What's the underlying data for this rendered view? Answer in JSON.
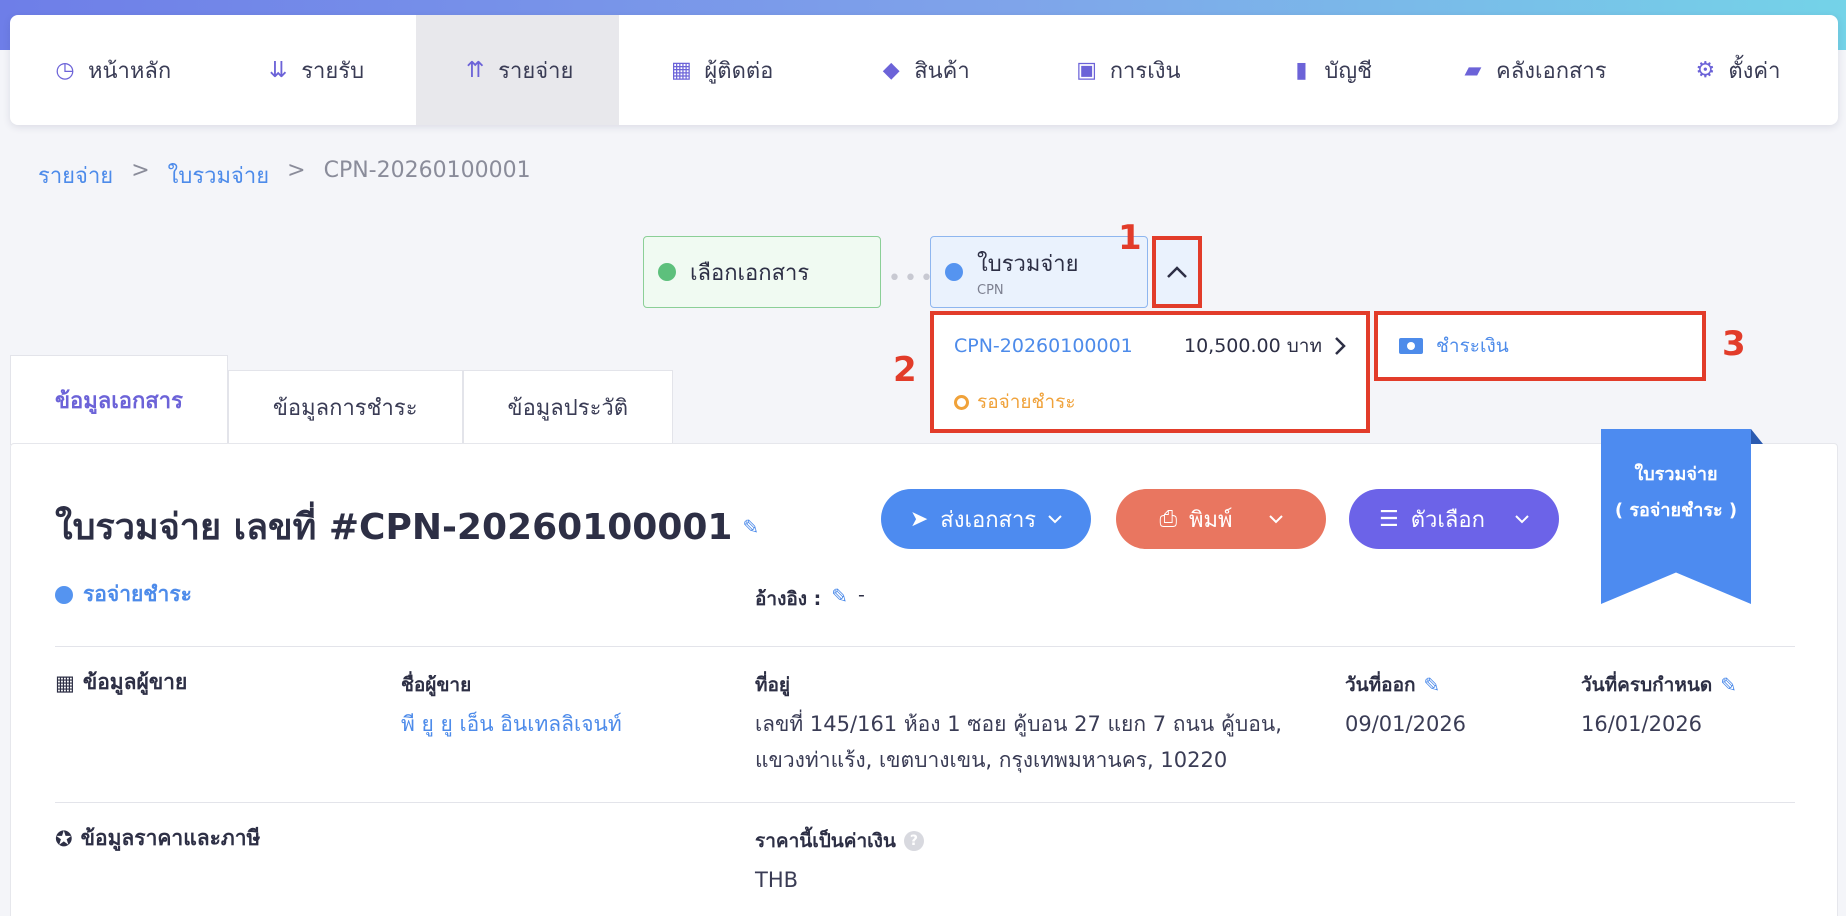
{
  "nav": [
    {
      "label": "หน้าหลัก",
      "icon": "dashboard-icon",
      "glyph": "◷",
      "active": false
    },
    {
      "label": "รายรับ",
      "icon": "income-icon",
      "glyph": "⇊",
      "active": false
    },
    {
      "label": "รายจ่าย",
      "icon": "expense-icon",
      "glyph": "⇈",
      "active": true
    },
    {
      "label": "ผู้ติดต่อ",
      "icon": "contacts-icon",
      "glyph": "▦",
      "active": false
    },
    {
      "label": "สินค้า",
      "icon": "box-icon",
      "glyph": "◆",
      "active": false
    },
    {
      "label": "การเงิน",
      "icon": "money-icon",
      "glyph": "▣",
      "active": false
    },
    {
      "label": "บัญชี",
      "icon": "ledger-icon",
      "glyph": "▮",
      "active": false
    },
    {
      "label": "คลังเอกสาร",
      "icon": "folder-icon",
      "glyph": "▰",
      "active": false
    },
    {
      "label": "ตั้งค่า",
      "icon": "gear-icon",
      "glyph": "⚙",
      "active": false
    }
  ],
  "breadcrumb": {
    "items": [
      "รายจ่าย",
      "ใบรวมจ่าย"
    ],
    "separator": ">",
    "current": "CPN-20260100001"
  },
  "steps": {
    "step1": {
      "label": "เลือกเอกสาร"
    },
    "step2": {
      "label": "ใบรวมจ่าย",
      "sub": "CPN"
    },
    "connector": "•••"
  },
  "annotations": {
    "a1": "1",
    "a2": "2",
    "a3": "3"
  },
  "dropdown": {
    "doc_no": "CPN-20260100001",
    "amount": "10,500.00 บาท",
    "status": "รอจ่ายชำระ",
    "action": "ชำระเงิน"
  },
  "tabs": [
    "ข้อมูลเอกสาร",
    "ข้อมูลการชำระ",
    "ข้อมูลประวัติ"
  ],
  "document": {
    "title": "ใบรวมจ่าย เลขที่ #CPN-20260100001",
    "status": "รอจ่ายชำระ",
    "reference_label": "อ้างอิง :",
    "reference_value": "-",
    "buttons": {
      "send": "ส่งเอกสาร",
      "print": "พิมพ์",
      "options": "ตัวเลือก"
    },
    "ribbon": {
      "line1": "ใบรวมจ่าย",
      "line2": "( รอจ่ายชำระ )"
    }
  },
  "vendor_section": {
    "title": "ข้อมูลผู้ขาย",
    "name_label": "ชื่อผู้ขาย",
    "name_value": "พี ยู ยู เอ็น อินเทลลิเจนท์",
    "address_label": "ที่อยู่",
    "address_line1": "เลขที่ 145/161 ห้อง 1 ซอย คู้บอน 27 แยก 7 ถนน คู้บอน,",
    "address_line2": "แขวงท่าแร้ง, เขตบางเขน, กรุงเทพมหานคร, 10220",
    "issue_label": "วันที่ออก",
    "issue_value": "09/01/2026",
    "due_label": "วันที่ครบกำหนด",
    "due_value": "16/01/2026"
  },
  "price_section": {
    "title": "ข้อมูลราคาและภาษี",
    "currency_label": "ราคานี้เป็นค่าเงิน",
    "currency_value": "THB"
  },
  "colors": {
    "accent": "#6c63d8",
    "link": "#4d8bea",
    "annotation": "#e23c2a",
    "pending": "#f0a23a"
  }
}
